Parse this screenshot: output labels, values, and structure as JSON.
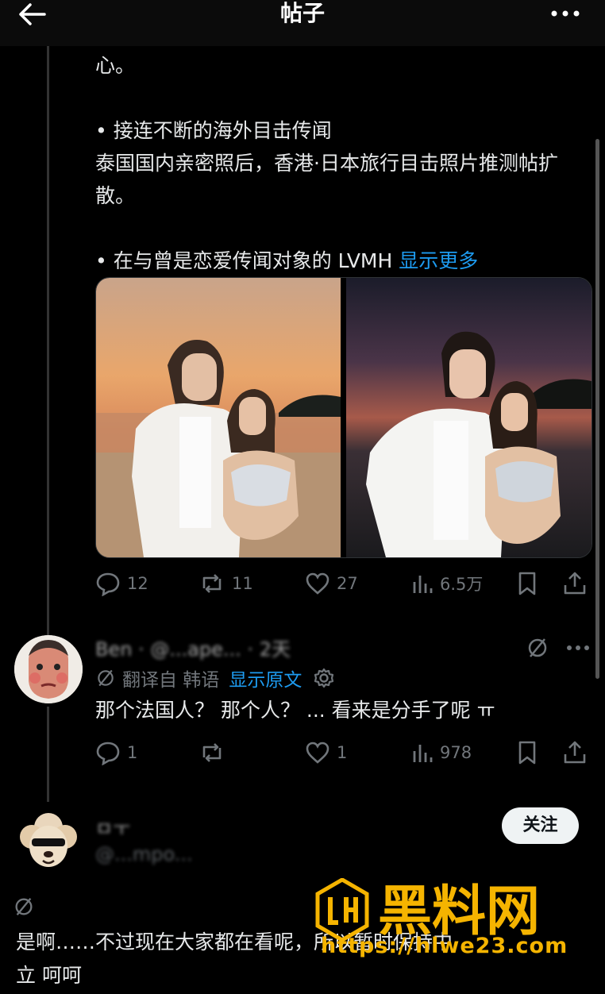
{
  "header": {
    "title": "帖子"
  },
  "post": {
    "text": "心。\n\n• 接连不断的海外目击传闻\n泰国国内亲密照后，香港·日本旅行目击照片推测帖扩散。\n\n• 在与曾是恋爱传闻对象的 LVMH ",
    "show_more": "显示更多",
    "stats": {
      "replies": "12",
      "reposts": "11",
      "likes": "27",
      "views": "6.5万"
    }
  },
  "reply1": {
    "author_line": "Ben · @...ape... · 2天",
    "translate_label": "翻译自 韩语",
    "show_original": "显示原文",
    "text": "那个法国人？ 那个人？ ... 看来是分手了呢 ㅠ",
    "stats": {
      "replies": "1",
      "likes": "1",
      "views": "978"
    }
  },
  "reply2": {
    "name": "ㅁㅜ",
    "handle": "@...mpo...",
    "follow_label": "关注",
    "text_line1": "是啊……不过现在大家都在看呢，所以暂时保持中",
    "text_line2": "立 呵呵"
  },
  "watermark": {
    "brand": "黑料网",
    "url": "https://hlwe23.com"
  },
  "colors": {
    "accent": "#1d9bf0",
    "muted": "#71767b",
    "watermark": "#f5b400"
  }
}
